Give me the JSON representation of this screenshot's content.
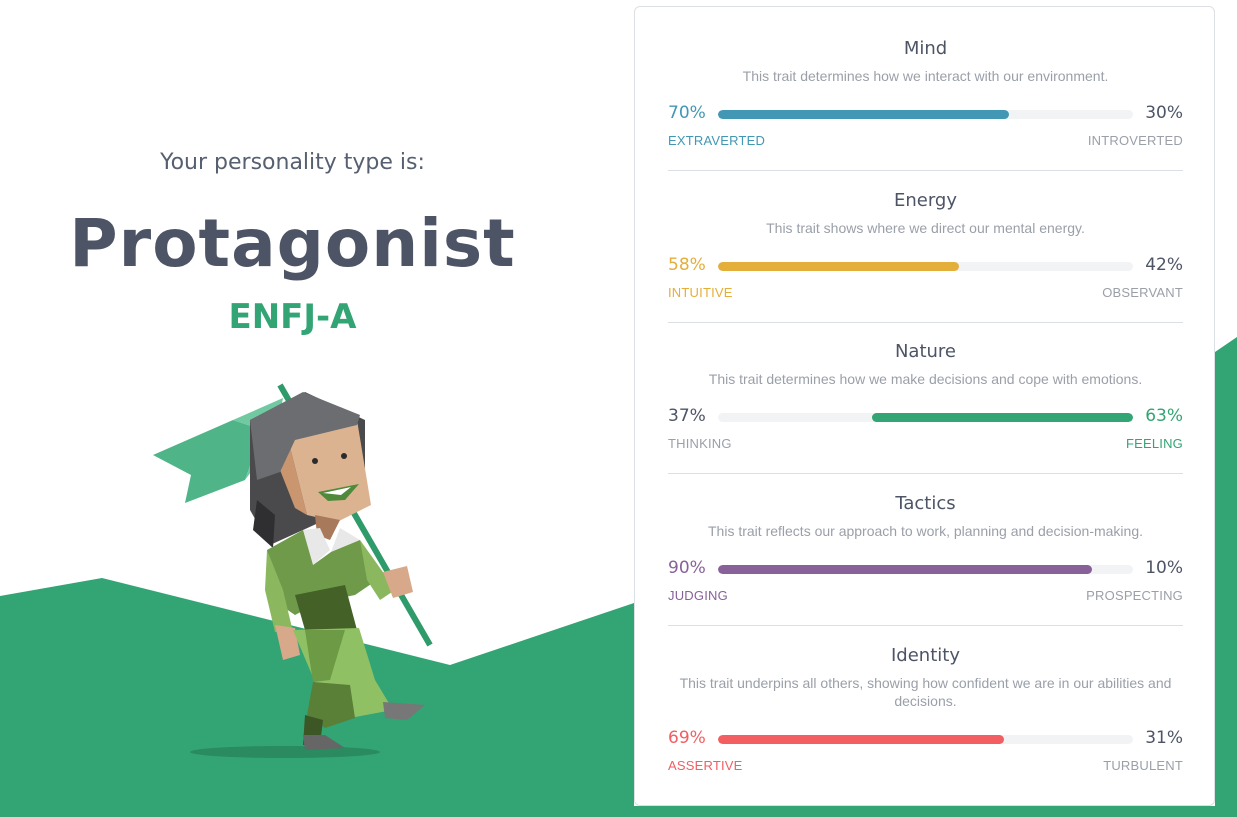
{
  "header": {
    "subtitle": "Your personality type is:",
    "type_name": "Protagonist",
    "type_code": "ENFJ-A"
  },
  "colors": {
    "brand_green": "#33a474",
    "mind": "#4298b4",
    "energy": "#e4ae3a",
    "nature": "#33a474",
    "tactics": "#88619a",
    "identity": "#f25e62",
    "muted": "#9a9fa8",
    "dark": "#4d5466"
  },
  "traits": [
    {
      "title": "Mind",
      "description": "This trait determines how we interact with our environment.",
      "left_pct": "70%",
      "right_pct": "30%",
      "left_label": "EXTRAVERTED",
      "right_label": "INTROVERTED",
      "dominant": "left",
      "value": 0.7,
      "color": "#4298b4"
    },
    {
      "title": "Energy",
      "description": "This trait shows where we direct our mental energy.",
      "left_pct": "58%",
      "right_pct": "42%",
      "left_label": "INTUITIVE",
      "right_label": "OBSERVANT",
      "dominant": "left",
      "value": 0.58,
      "color": "#e4ae3a"
    },
    {
      "title": "Nature",
      "description": "This trait determines how we make decisions and cope with emotions.",
      "left_pct": "37%",
      "right_pct": "63%",
      "left_label": "THINKING",
      "right_label": "FEELING",
      "dominant": "right",
      "value": 0.63,
      "color": "#33a474"
    },
    {
      "title": "Tactics",
      "description": "This trait reflects our approach to work, planning and decision-making.",
      "left_pct": "90%",
      "right_pct": "10%",
      "left_label": "JUDGING",
      "right_label": "PROSPECTING",
      "dominant": "left",
      "value": 0.9,
      "color": "#88619a"
    },
    {
      "title": "Identity",
      "description": "This trait underpins all others, showing how confident we are in our abilities and decisions.",
      "left_pct": "69%",
      "right_pct": "31%",
      "left_label": "ASSERTIVE",
      "right_label": "TURBULENT",
      "dominant": "left",
      "value": 0.69,
      "color": "#f25e62"
    }
  ]
}
